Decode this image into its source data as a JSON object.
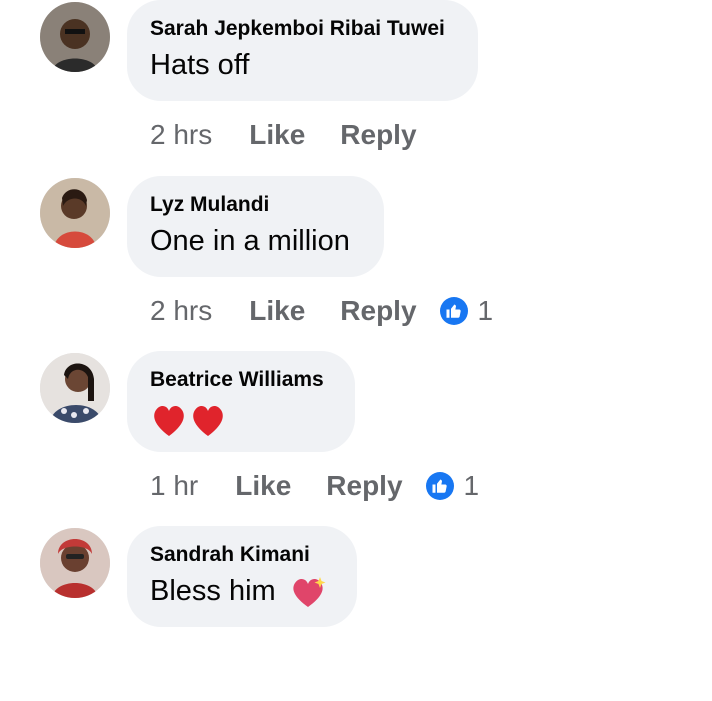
{
  "comments": [
    {
      "name": "Sarah Jepkemboi Ribai Tuwei",
      "text": "Hats off",
      "time": "2 hrs",
      "like_label": "Like",
      "reply_label": "Reply",
      "reaction_count": ""
    },
    {
      "name": "Lyz Mulandi",
      "text": "One in a million",
      "time": "2 hrs",
      "like_label": "Like",
      "reply_label": "Reply",
      "reaction_count": "1"
    },
    {
      "name": "Beatrice Williams",
      "text": "",
      "time": "1 hr",
      "like_label": "Like",
      "reply_label": "Reply",
      "reaction_count": "1"
    },
    {
      "name": "Sandrah Kimani",
      "text": "Bless him",
      "time": "",
      "like_label": "",
      "reply_label": "",
      "reaction_count": ""
    }
  ],
  "colors": {
    "bubble": "#f0f2f5",
    "meta_text": "#65676b",
    "like_blue": "#1877f2",
    "heart_red": "#e0242c"
  }
}
